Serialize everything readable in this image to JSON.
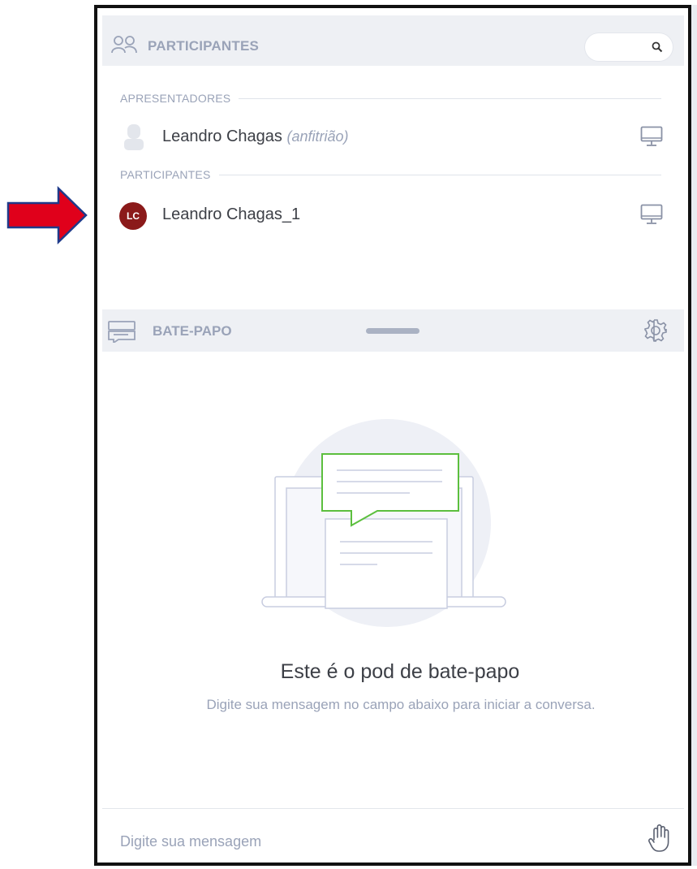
{
  "participants_panel": {
    "title": "PARTICIPANTES",
    "search_placeholder": "",
    "sections": [
      {
        "label": "APRESENTADORES",
        "people": [
          {
            "name": "Leandro Chagas",
            "role": "(anfitrião)",
            "avatar": "person-placeholder-icon"
          }
        ]
      },
      {
        "label": "PARTICIPANTES",
        "people": [
          {
            "name": "Leandro Chagas_1",
            "initials": "LC",
            "avatar_color": "#8b1a1a"
          }
        ]
      }
    ]
  },
  "chat_panel": {
    "title": "BATE-PAPO",
    "empty_title": "Este é o pod de bate-papo",
    "empty_subtitle": "Digite sua mensagem no campo abaixo para iniciar a conversa.",
    "input_placeholder": "Digite sua mensagem"
  },
  "colors": {
    "header_bg": "#eef0f4",
    "muted_text": "#9aa3b8",
    "accent_green": "#5cbf3e",
    "arrow_red": "#e0001b",
    "arrow_outline": "#1f3a8a"
  }
}
